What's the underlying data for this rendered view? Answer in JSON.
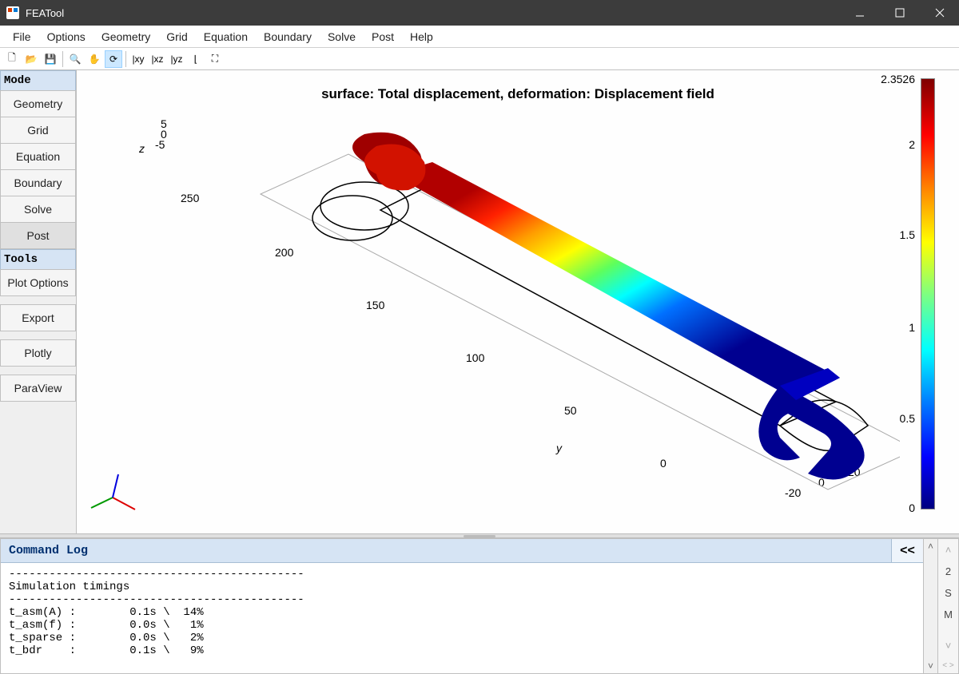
{
  "window": {
    "title": "FEATool"
  },
  "menu": {
    "items": [
      "File",
      "Options",
      "Geometry",
      "Grid",
      "Equation",
      "Boundary",
      "Solve",
      "Post",
      "Help"
    ]
  },
  "toolbar": {
    "buttons": [
      {
        "name": "new-file",
        "glyph": "🗋"
      },
      {
        "name": "open-file",
        "glyph": "📂"
      },
      {
        "name": "save-file",
        "glyph": "💾"
      },
      {
        "name": "zoom",
        "glyph": "🔍"
      },
      {
        "name": "pan",
        "glyph": "✋"
      },
      {
        "name": "rotate",
        "glyph": "⟳",
        "active": true
      },
      {
        "name": "xy-view",
        "glyph": "|xy"
      },
      {
        "name": "xz-view",
        "glyph": "|xz"
      },
      {
        "name": "yz-view",
        "glyph": "|yz"
      },
      {
        "name": "3d-view",
        "glyph": "⌊"
      },
      {
        "name": "fit-view",
        "glyph": "⛶"
      }
    ]
  },
  "sidebar": {
    "s1_header": "Mode",
    "mode_items": [
      {
        "label": "Geometry",
        "name": "geometry"
      },
      {
        "label": "Grid",
        "name": "grid"
      },
      {
        "label": "Equation",
        "name": "equation"
      },
      {
        "label": "Boundary",
        "name": "boundary"
      },
      {
        "label": "Solve",
        "name": "solve"
      },
      {
        "label": "Post",
        "name": "post",
        "active": true
      }
    ],
    "s2_header": "Tools",
    "tool_items": [
      {
        "label": "Plot Options",
        "name": "plot-options"
      },
      {
        "label": "Export",
        "name": "export"
      },
      {
        "label": "Plotly",
        "name": "plotly"
      },
      {
        "label": "ParaView",
        "name": "paraview"
      }
    ]
  },
  "plot": {
    "title": "surface: Total displacement, deformation: Displacement field",
    "z_label": "z",
    "z_ticks": [
      "5",
      "0",
      "-5"
    ],
    "y_label": "y",
    "y_ticks": [
      "250",
      "200",
      "150",
      "100",
      "50",
      "0"
    ],
    "x_ticks": [
      "-20",
      "0",
      "20"
    ],
    "colorbar": {
      "ticks": [
        "2.3526",
        "2",
        "1.5",
        "1",
        "0.5",
        "0"
      ]
    }
  },
  "log": {
    "title": "Command Log",
    "collapse": "<<",
    "lines": [
      "--------------------------------------------",
      "Simulation timings",
      "--------------------------------------------",
      "t_asm(A) :        0.1s \\  14%",
      "t_asm(f) :        0.0s \\   1%",
      "t_sparse :        0.0s \\   2%",
      "t_bdr    :        0.1s \\   9%"
    ],
    "minipanel": [
      "2",
      "S",
      "M"
    ]
  }
}
